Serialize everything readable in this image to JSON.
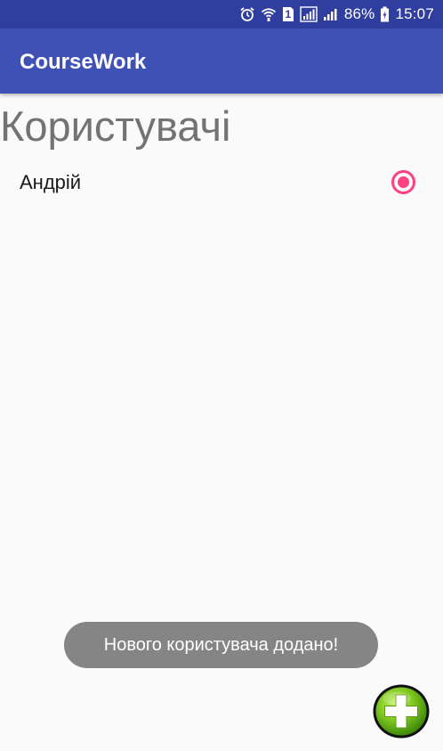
{
  "status_bar": {
    "battery_percent": "86%",
    "time": "15:07",
    "sim_badge": "1",
    "icons": [
      "alarm-icon",
      "wifi-icon",
      "sim-icon",
      "signal-sim1-icon",
      "signal-sim2-icon",
      "battery-charging-icon"
    ]
  },
  "app_bar": {
    "title": "CourseWork",
    "color": "#3f51b5",
    "status_color": "#303f9f"
  },
  "main": {
    "heading": "Користувачі",
    "users": [
      {
        "name": "Андрій",
        "selected": true
      }
    ]
  },
  "toast": {
    "message": "Нового користувача додано!"
  },
  "fab": {
    "icon": "add-plus-icon",
    "accent": "#7ec51e"
  },
  "colors": {
    "radio_accent": "#ff4081"
  }
}
